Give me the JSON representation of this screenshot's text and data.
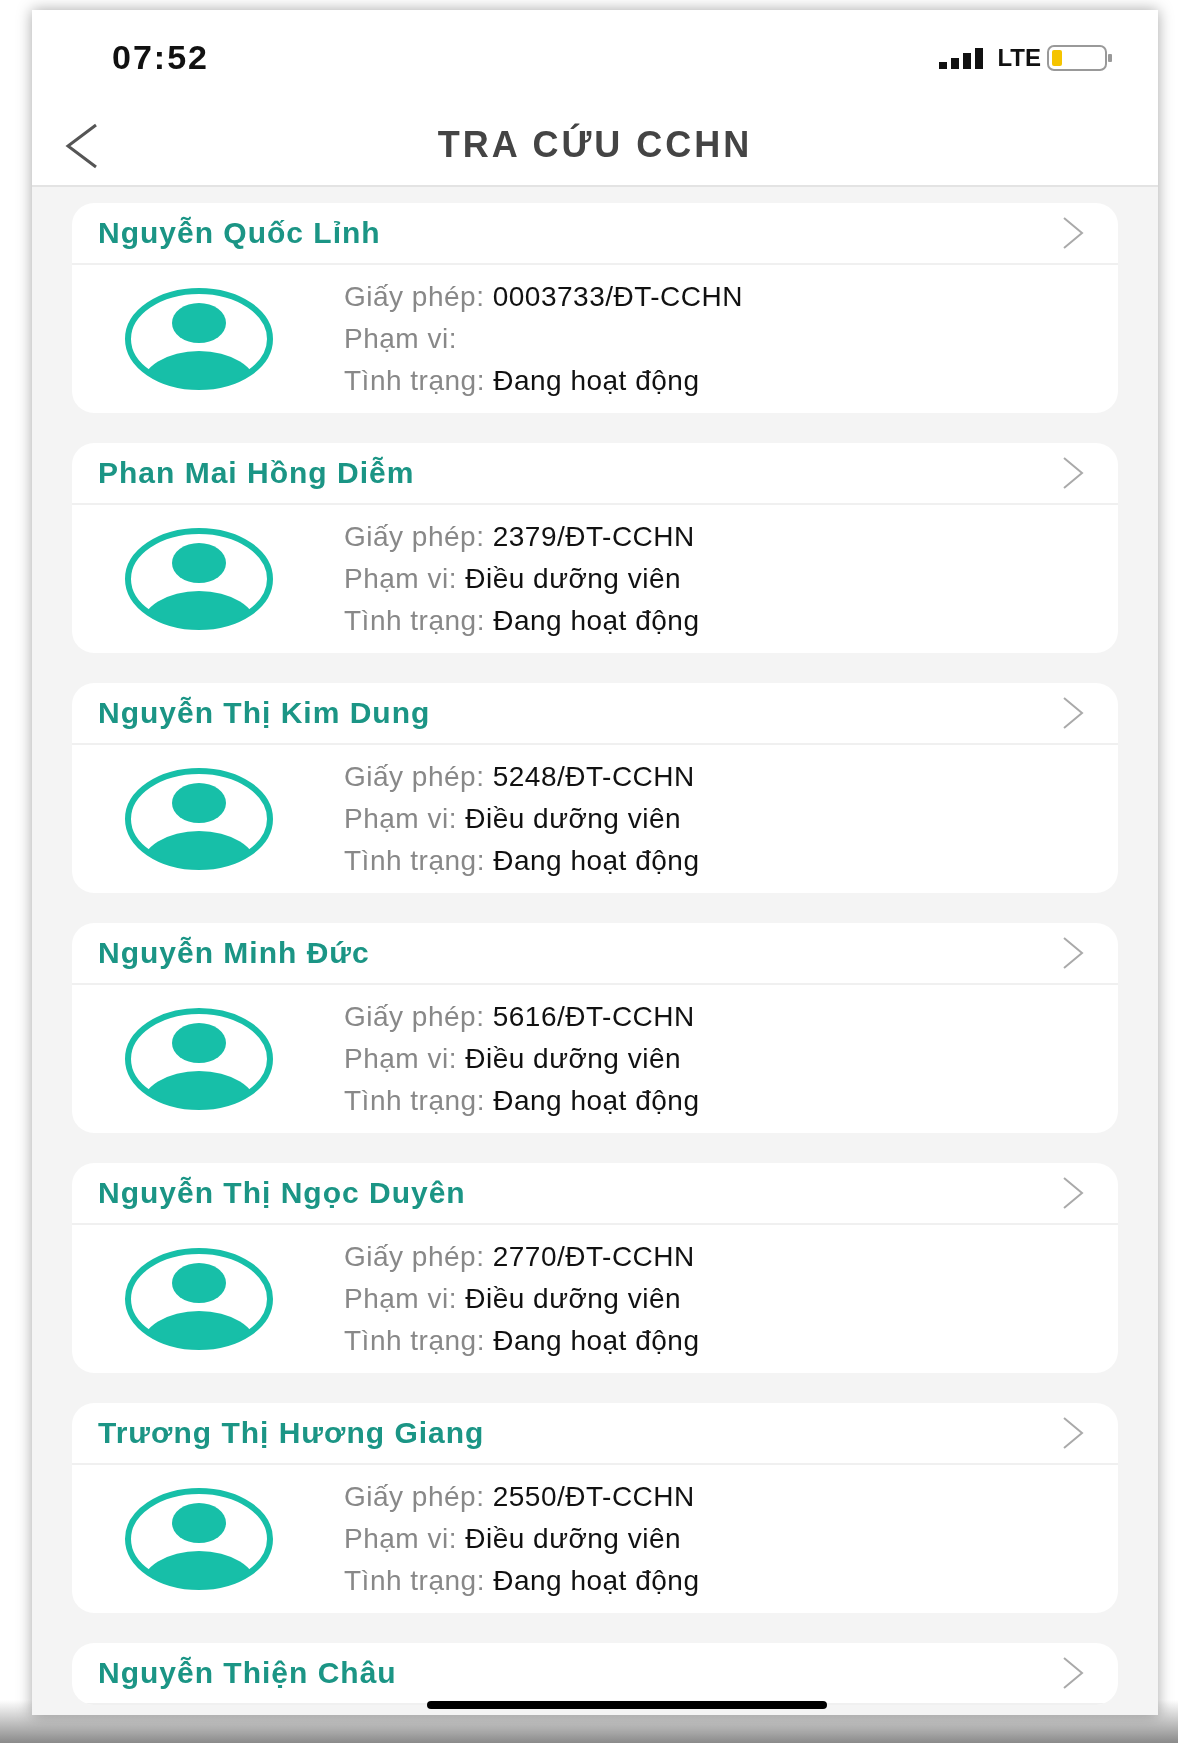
{
  "status_bar": {
    "time": "07:52",
    "network": "LTE"
  },
  "header": {
    "title": "TRA CỨU CCHN"
  },
  "records": [
    {
      "name": "Nguyễn Quốc Lỉnh",
      "fields": [
        {
          "label": "Giấy phép:",
          "value": "0003733/ĐT-CCHN"
        },
        {
          "label": "Phạm vi:"
        },
        {
          "label": "Tình trạng:",
          "value": "Đang hoạt động"
        }
      ]
    },
    {
      "name": "Phan Mai Hồng Diễm",
      "fields": [
        {
          "label": "Giấy phép:",
          "value": "2379/ĐT-CCHN"
        },
        {
          "label": "Phạm vi:",
          "value": "Điều dưỡng viên"
        },
        {
          "label": "Tình trạng:",
          "value": "Đang hoạt động"
        }
      ]
    },
    {
      "name": "Nguyễn Thị Kim Dung",
      "fields": [
        {
          "label": "Giấy phép:",
          "value": "5248/ĐT-CCHN"
        },
        {
          "label": "Phạm vi:",
          "value": "Điều dưỡng viên"
        },
        {
          "label": "Tình trạng:",
          "value": "Đang hoạt động"
        }
      ]
    },
    {
      "name": "Nguyễn Minh Đức",
      "fields": [
        {
          "label": "Giấy phép:",
          "value": "5616/ĐT-CCHN"
        },
        {
          "label": "Phạm vi:",
          "value": "Điều dưỡng viên"
        },
        {
          "label": "Tình trạng:",
          "value": "Đang hoạt động"
        }
      ]
    },
    {
      "name": "Nguyễn Thị Ngọc Duyên",
      "fields": [
        {
          "label": "Giấy phép:",
          "value": "2770/ĐT-CCHN"
        },
        {
          "label": "Phạm vi:",
          "value": "Điều dưỡng viên"
        },
        {
          "label": "Tình trạng:",
          "value": "Đang hoạt động"
        }
      ]
    },
    {
      "name": "Trương Thị Hương Giang",
      "fields": [
        {
          "label": "Giấy phép:",
          "value": "2550/ĐT-CCHN"
        },
        {
          "label": "Phạm vi:",
          "value": "Điều dưỡng viên"
        },
        {
          "label": "Tình trạng:",
          "value": "Đang hoạt động"
        }
      ]
    },
    {
      "name": "Nguyễn Thiện Châu"
    }
  ]
}
